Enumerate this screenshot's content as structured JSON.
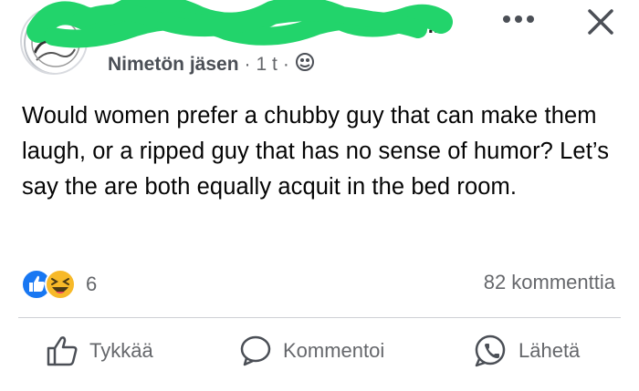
{
  "post": {
    "author_redacted": "y...",
    "member_label": "Nimetön jäsen",
    "time": "1 t",
    "text": "Would women prefer a chubby guy that can make them laugh, or a ripped guy that has no sense of humor? Let’s say the are both equally acquit in the bed room.",
    "reaction_count": "6",
    "comments_label": "82 kommenttia"
  },
  "actions": {
    "like_label": "Tykkää",
    "comment_label": "Kommentoi",
    "share_label": "Lähetä"
  },
  "colors": {
    "redaction": "#22d46b",
    "like_blue": "#1877f2",
    "haha_yellow": "#f7b928",
    "muted_text": "#65676b"
  },
  "icons": [
    "avatar",
    "more-options-icon",
    "close-icon",
    "privacy-globe-icon",
    "like-reaction-icon",
    "haha-reaction-icon",
    "thumbs-up-icon",
    "comment-bubble-icon",
    "messenger-icon"
  ]
}
